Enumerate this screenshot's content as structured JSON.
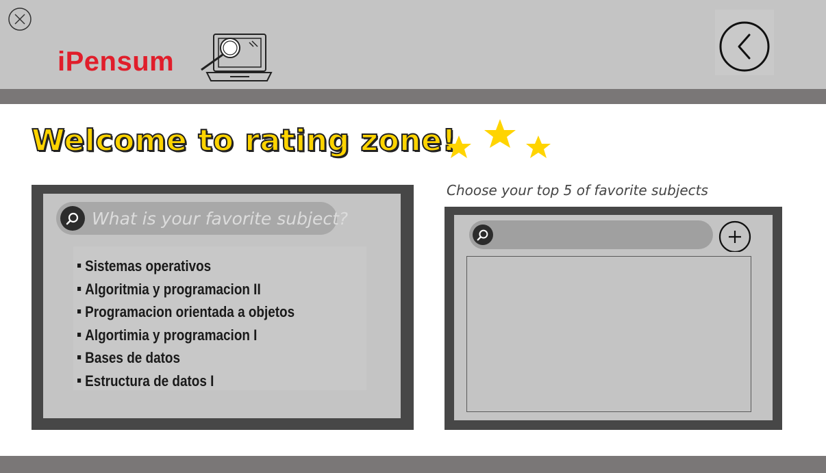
{
  "app": {
    "name": "iPensum"
  },
  "header": {
    "close_icon": "close-icon",
    "logo_icon": "laptop-magnifier-icon",
    "back_icon": "chevron-left-icon"
  },
  "page": {
    "title": "Welcome to rating zone!",
    "stars_icon": "stars-icon"
  },
  "search": {
    "placeholder": "What is your favorite subject?",
    "icon": "search-icon"
  },
  "subjects": [
    "Sistemas operativos",
    "Algoritmia y programacion II",
    "Programacion orientada a objetos",
    "Algortimia y programacion I",
    "Bases de datos",
    "Estructura de datos I"
  ],
  "favorites": {
    "label": "Choose your top 5 of favorite subjects",
    "search_value": "",
    "add_icon": "plus-icon",
    "items": []
  },
  "colors": {
    "brand_red": "#e01e2b",
    "title_yellow": "#ffd400",
    "header_gray": "#c4c4c4",
    "strip_gray": "#7a7777",
    "panel_dark": "#474747"
  }
}
